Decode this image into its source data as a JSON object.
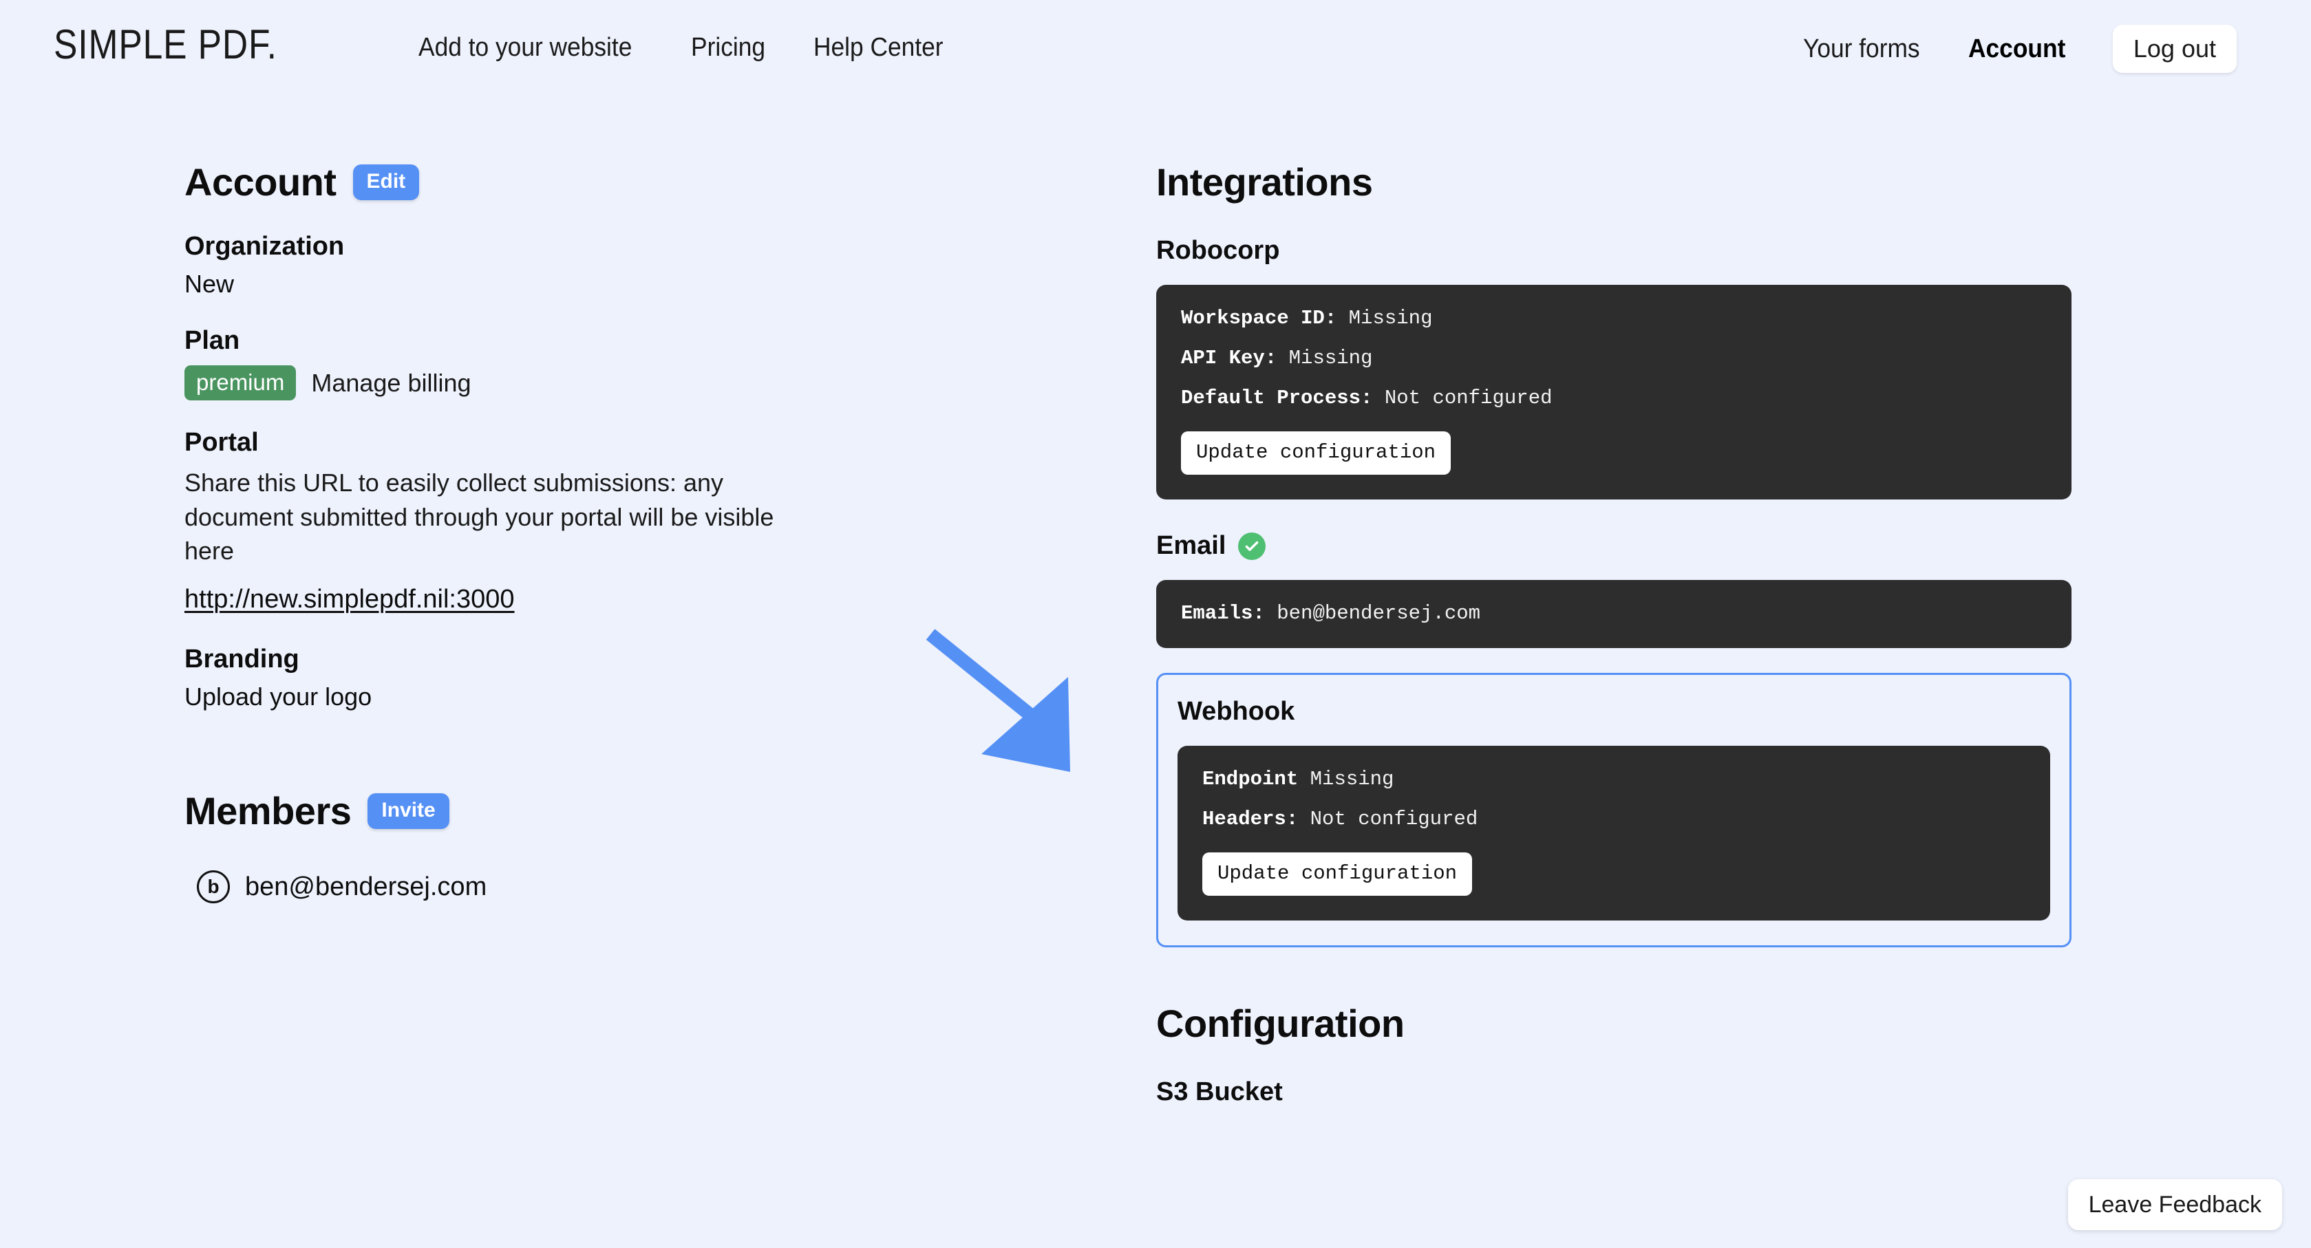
{
  "header": {
    "logo": "SIMPLE PDF.",
    "nav_left": [
      {
        "label": "Add to your website"
      },
      {
        "label": "Pricing"
      },
      {
        "label": "Help Center"
      }
    ],
    "nav_right": {
      "your_forms": "Your forms",
      "account": "Account",
      "logout": "Log out"
    }
  },
  "account": {
    "title": "Account",
    "edit_label": "Edit",
    "organization": {
      "label": "Organization",
      "value": "New"
    },
    "plan": {
      "label": "Plan",
      "badge": "premium",
      "manage_billing": "Manage billing"
    },
    "portal": {
      "label": "Portal",
      "description": "Share this URL to easily collect submissions: any document submitted through your portal will be visible here",
      "url": "http://new.simplepdf.nil:3000"
    },
    "branding": {
      "label": "Branding",
      "upload": "Upload your logo"
    }
  },
  "members": {
    "title": "Members",
    "invite_label": "Invite",
    "list": [
      {
        "initial": "b",
        "email": "ben@bendersej.com"
      }
    ]
  },
  "integrations": {
    "title": "Integrations",
    "robocorp": {
      "name": "Robocorp",
      "rows": [
        {
          "key": "Workspace ID:",
          "value": "Missing"
        },
        {
          "key": "API Key:",
          "value": "Missing"
        },
        {
          "key": "Default Process:",
          "value": "Not configured"
        }
      ],
      "update_label": "Update configuration"
    },
    "email": {
      "name": "Email",
      "status_icon": "check-circle-icon",
      "rows": [
        {
          "key": "Emails:",
          "value": "ben@bendersej.com"
        }
      ]
    },
    "webhook": {
      "name": "Webhook",
      "rows": [
        {
          "key": "Endpoint",
          "value": "Missing"
        },
        {
          "key": "Headers:",
          "value": "Not configured"
        }
      ],
      "update_label": "Update configuration",
      "highlighted": true
    }
  },
  "configuration": {
    "title": "Configuration",
    "s3_bucket": "S3 Bucket"
  },
  "feedback": {
    "label": "Leave Feedback"
  },
  "annotation": {
    "type": "arrow",
    "points_to": "webhook-card",
    "color": "#5590f5"
  },
  "colors": {
    "page_background": "#eef2fd",
    "accent_blue": "#5590f5",
    "badge_green": "#4a9460",
    "status_green": "#4fbf72",
    "code_background": "#2d2d2d"
  }
}
